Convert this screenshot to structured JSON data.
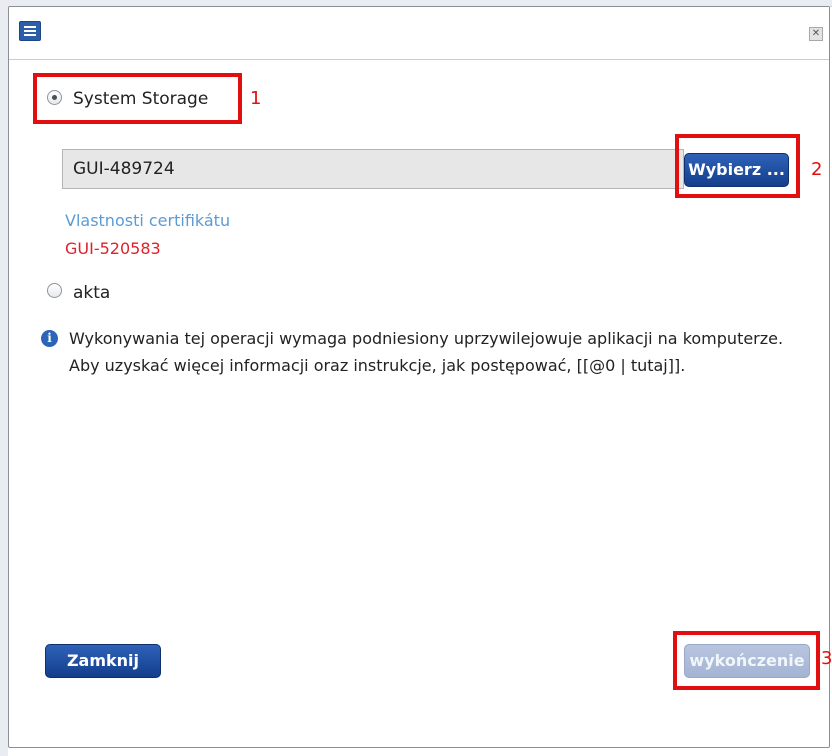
{
  "dialog": {
    "app_icon": "dialog-app-icon",
    "close_icon": "close-icon",
    "close_glyph": "✕"
  },
  "options": {
    "system_storage": {
      "label": "System Storage",
      "selected": true
    },
    "akta": {
      "label": "akta",
      "selected": false
    }
  },
  "certificate": {
    "value": "GUI-489724",
    "choose_button": "Wybierz ...",
    "properties_link": "Vlastnosti certifikátu",
    "error_id": "GUI-520583"
  },
  "info": {
    "icon": "info-icon",
    "icon_glyph": "i",
    "text": "Wykonywania tej operacji wymaga podniesiony uprzywilejowuje aplikacji na komputerze. Aby uzyskać więcej informacji oraz instrukcje, jak postępować, [[@0 | tutaj]]."
  },
  "footer": {
    "close_button": "Zamknij",
    "finish_button": "wykończenie",
    "finish_enabled": false
  },
  "annotations": {
    "marker_1": "1",
    "marker_2": "2",
    "marker_3": "3",
    "color": "#e10f0f"
  },
  "colors": {
    "primary_button": "#1f4fa0",
    "link": "#5b9bd5",
    "error_text": "#e0202a",
    "info_icon": "#2c64b8"
  }
}
